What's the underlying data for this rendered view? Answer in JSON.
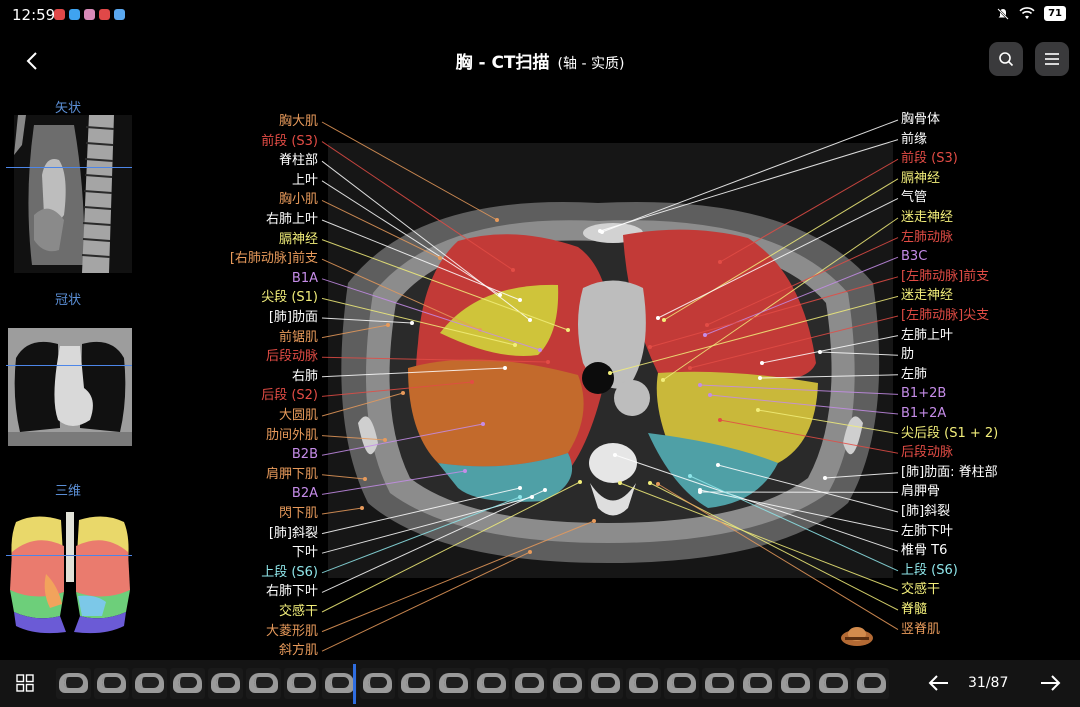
{
  "status": {
    "time": "12:59",
    "battery": "71"
  },
  "header": {
    "title": "胸 - CT扫描",
    "subtitle": "(轴 - 实质)"
  },
  "sidebar": {
    "sagittal": "矢状",
    "coronal": "冠状",
    "three_d": "三维"
  },
  "left_labels": [
    "胸大肌",
    "前段 (S3)",
    "脊柱部",
    "上叶",
    "胸小肌",
    "右肺上叶",
    "膈神经",
    "[右肺动脉]前支",
    "B1A",
    "尖段 (S1)",
    "[肺]肋面",
    "前锯肌",
    "后段动脉",
    "右肺",
    "后段 (S2)",
    "大圆肌",
    "肋间外肌",
    "B2B",
    "肩胛下肌",
    "B2A",
    "閃下肌",
    "[肺]斜裂",
    "下叶",
    "上段 (S6)",
    "右肺下叶",
    "交感干",
    "大菱形肌",
    "斜方肌"
  ],
  "right_labels": [
    "胸骨体",
    "前缘",
    "前段 (S3)",
    "膈神经",
    "气管",
    "迷走神经",
    "左肺动脉",
    "B3C",
    "[左肺动脉]前支",
    "迷走神经",
    "[左肺动脉]尖支",
    "左肺上叶",
    "肋",
    "左肺",
    "B1+2B",
    "B1+2A",
    "尖后段 (S1 + 2)",
    "后段动脉",
    "[肺]肋面: 脊柱部",
    "肩胛骨",
    "[肺]斜裂",
    "左肺下叶",
    "椎骨 T6",
    "上段 (S6)",
    "交感干",
    "脊髓",
    "竖脊肌"
  ],
  "colors": {
    "orange": "#e79a5b",
    "red": "#e24c45",
    "white": "#ffffff",
    "yellow": "#f2ee7a",
    "violet": "#c58ce8",
    "cyan": "#8fe6ea",
    "accent": "#2f6de0"
  },
  "left_colors": [
    "orange",
    "red",
    "white",
    "white",
    "orange",
    "white",
    "yellow",
    "orange",
    "violet",
    "yellow",
    "white",
    "orange",
    "red",
    "white",
    "red",
    "orange",
    "orange",
    "violet",
    "orange",
    "violet",
    "orange",
    "white",
    "white",
    "cyan",
    "white",
    "yellow",
    "orange",
    "orange"
  ],
  "right_colors": [
    "white",
    "white",
    "red",
    "yellow",
    "white",
    "yellow",
    "red",
    "violet",
    "red",
    "yellow",
    "red",
    "white",
    "white",
    "white",
    "violet",
    "violet",
    "yellow",
    "red",
    "white",
    "white",
    "white",
    "white",
    "white",
    "cyan",
    "yellow",
    "yellow",
    "orange"
  ],
  "pagination": {
    "current": "31",
    "total": "87",
    "text": "31/87"
  }
}
